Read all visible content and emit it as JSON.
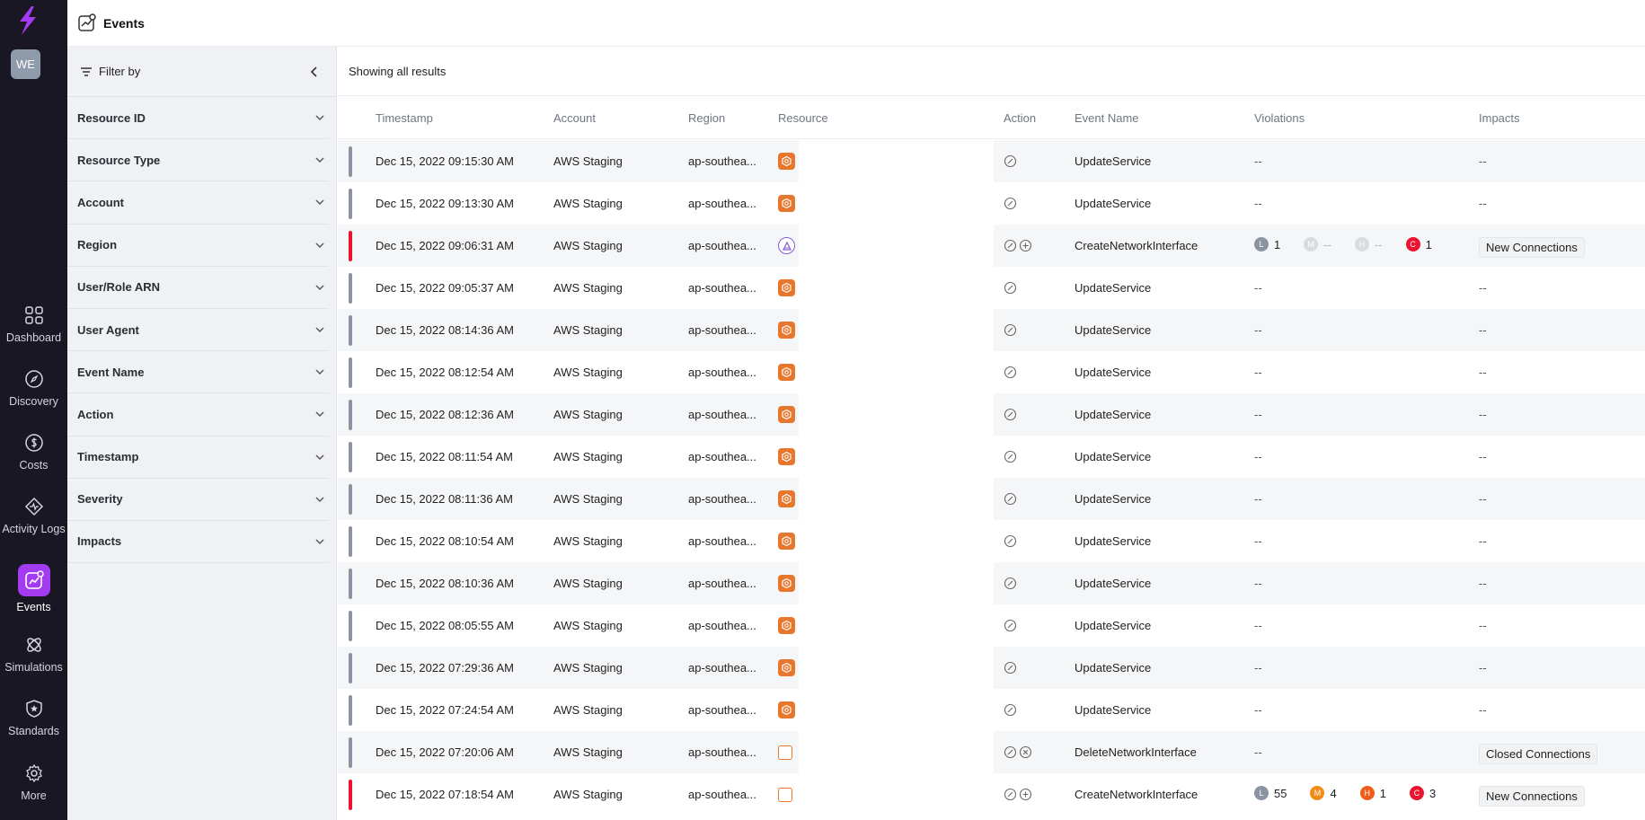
{
  "nav": {
    "avatar": "WE",
    "items": [
      {
        "label": "Dashboard",
        "icon": "grid-icon"
      },
      {
        "label": "Discovery",
        "icon": "compass-icon"
      },
      {
        "label": "Costs",
        "icon": "dollar-icon"
      },
      {
        "label": "Activity Logs",
        "icon": "activity-icon"
      },
      {
        "label": "Events",
        "icon": "events-icon",
        "active": true
      },
      {
        "label": "Simulations",
        "icon": "atom-icon"
      },
      {
        "label": "Standards",
        "icon": "shield-star-icon"
      },
      {
        "label": "More",
        "icon": "gear-icon"
      }
    ]
  },
  "header": {
    "title": "Events"
  },
  "filters": {
    "title": "Filter by",
    "items": [
      "Resource ID",
      "Resource Type",
      "Account",
      "Region",
      "User/Role ARN",
      "User Agent",
      "Event Name",
      "Action",
      "Timestamp",
      "Severity",
      "Impacts"
    ]
  },
  "results": {
    "summary": "Showing all results"
  },
  "table": {
    "columns": {
      "timestamp": "Timestamp",
      "account": "Account",
      "region": "Region",
      "resource": "Resource",
      "action": "Action",
      "event": "Event Name",
      "violations": "Violations",
      "impacts": "Impacts"
    },
    "rows": [
      {
        "ts": "Dec 15, 2022 09:15:30 AM",
        "account": "AWS Staging",
        "region": "ap-southea...",
        "res": "orange",
        "actions": [
          "edit"
        ],
        "event": "UpdateService",
        "sev": "low",
        "violations": null,
        "impact": "--"
      },
      {
        "ts": "Dec 15, 2022 09:13:30 AM",
        "account": "AWS Staging",
        "region": "ap-southea...",
        "res": "orange",
        "actions": [
          "edit"
        ],
        "event": "UpdateService",
        "sev": "low",
        "violations": null,
        "impact": "--"
      },
      {
        "ts": "Dec 15, 2022 09:06:31 AM",
        "account": "AWS Staging",
        "region": "ap-southea...",
        "res": "purple",
        "actions": [
          "edit",
          "add"
        ],
        "event": "CreateNetworkInterface",
        "sev": "critical",
        "violations": {
          "L": "1",
          "M": "--",
          "H": "--",
          "C": "1"
        },
        "impact": "New Connections"
      },
      {
        "ts": "Dec 15, 2022 09:05:37 AM",
        "account": "AWS Staging",
        "region": "ap-southea...",
        "res": "orange",
        "actions": [
          "edit"
        ],
        "event": "UpdateService",
        "sev": "low",
        "violations": null,
        "impact": "--"
      },
      {
        "ts": "Dec 15, 2022 08:14:36 AM",
        "account": "AWS Staging",
        "region": "ap-southea...",
        "res": "orange",
        "actions": [
          "edit"
        ],
        "event": "UpdateService",
        "sev": "low",
        "violations": null,
        "impact": "--"
      },
      {
        "ts": "Dec 15, 2022 08:12:54 AM",
        "account": "AWS Staging",
        "region": "ap-southea...",
        "res": "orange",
        "actions": [
          "edit"
        ],
        "event": "UpdateService",
        "sev": "low",
        "violations": null,
        "impact": "--"
      },
      {
        "ts": "Dec 15, 2022 08:12:36 AM",
        "account": "AWS Staging",
        "region": "ap-southea...",
        "res": "orange",
        "actions": [
          "edit"
        ],
        "event": "UpdateService",
        "sev": "low",
        "violations": null,
        "impact": "--"
      },
      {
        "ts": "Dec 15, 2022 08:11:54 AM",
        "account": "AWS Staging",
        "region": "ap-southea...",
        "res": "orange",
        "actions": [
          "edit"
        ],
        "event": "UpdateService",
        "sev": "low",
        "violations": null,
        "impact": "--"
      },
      {
        "ts": "Dec 15, 2022 08:11:36 AM",
        "account": "AWS Staging",
        "region": "ap-southea...",
        "res": "orange",
        "actions": [
          "edit"
        ],
        "event": "UpdateService",
        "sev": "low",
        "violations": null,
        "impact": "--"
      },
      {
        "ts": "Dec 15, 2022 08:10:54 AM",
        "account": "AWS Staging",
        "region": "ap-southea...",
        "res": "orange",
        "actions": [
          "edit"
        ],
        "event": "UpdateService",
        "sev": "low",
        "violations": null,
        "impact": "--"
      },
      {
        "ts": "Dec 15, 2022 08:10:36 AM",
        "account": "AWS Staging",
        "region": "ap-southea...",
        "res": "orange",
        "actions": [
          "edit"
        ],
        "event": "UpdateService",
        "sev": "low",
        "violations": null,
        "impact": "--"
      },
      {
        "ts": "Dec 15, 2022 08:05:55 AM",
        "account": "AWS Staging",
        "region": "ap-southea...",
        "res": "orange",
        "actions": [
          "edit"
        ],
        "event": "UpdateService",
        "sev": "low",
        "violations": null,
        "impact": "--"
      },
      {
        "ts": "Dec 15, 2022 07:29:36 AM",
        "account": "AWS Staging",
        "region": "ap-southea...",
        "res": "orange",
        "actions": [
          "edit"
        ],
        "event": "UpdateService",
        "sev": "low",
        "violations": null,
        "impact": "--"
      },
      {
        "ts": "Dec 15, 2022 07:24:54 AM",
        "account": "AWS Staging",
        "region": "ap-southea...",
        "res": "orange",
        "actions": [
          "edit"
        ],
        "event": "UpdateService",
        "sev": "low",
        "violations": null,
        "impact": "--"
      },
      {
        "ts": "Dec 15, 2022 07:20:06 AM",
        "account": "AWS Staging",
        "region": "ap-southea...",
        "res": "empty",
        "actions": [
          "edit",
          "remove"
        ],
        "event": "DeleteNetworkInterface",
        "sev": "low",
        "violations": null,
        "impact": "Closed Connections"
      },
      {
        "ts": "Dec 15, 2022 07:18:54 AM",
        "account": "AWS Staging",
        "region": "ap-southea...",
        "res": "empty",
        "actions": [
          "edit",
          "add"
        ],
        "event": "CreateNetworkInterface",
        "sev": "critical",
        "violations": {
          "L": "55",
          "M": "4",
          "H": "1",
          "C": "3"
        },
        "impact": "New Connections"
      }
    ]
  },
  "colors": {
    "accent": "#a33bf2",
    "critical": "#ec1330",
    "neutral": "#8c94a4",
    "resource": "#e8772e"
  }
}
